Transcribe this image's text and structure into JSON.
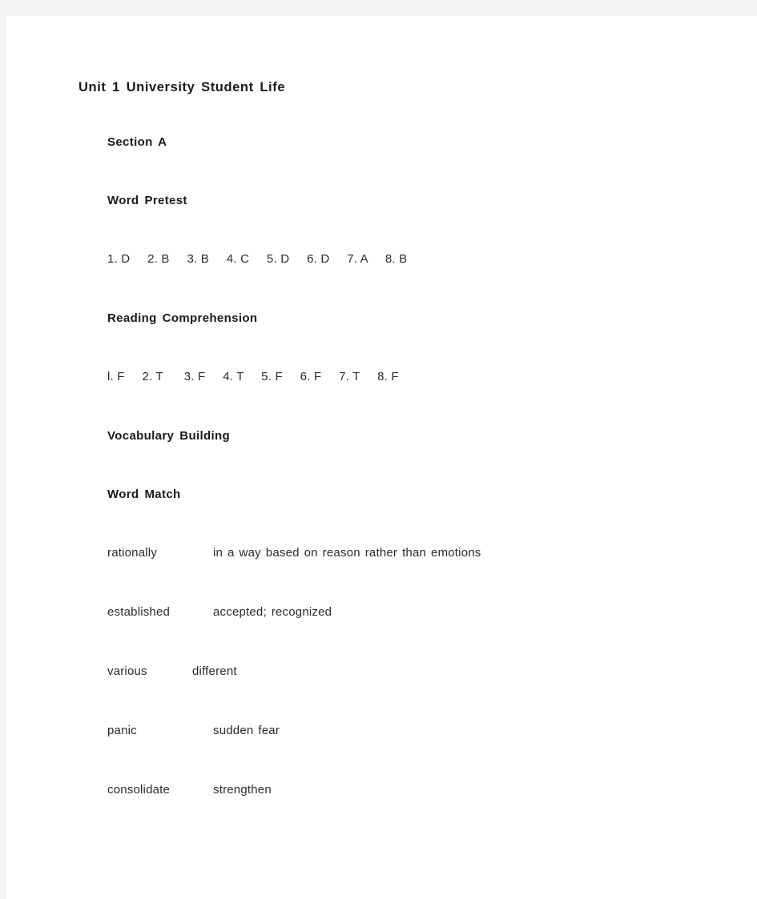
{
  "document": {
    "title": "Unit 1 University Student Life",
    "section_label": "Section A"
  },
  "word_pretest": {
    "heading": "Word Pretest",
    "answers_line": "1. D     2. B     3. B     4. C     5. D     6. D     7. A     8. B",
    "answers": [
      {
        "number": "1.",
        "value": "D"
      },
      {
        "number": "2.",
        "value": "B"
      },
      {
        "number": "3.",
        "value": "B"
      },
      {
        "number": "4.",
        "value": "C"
      },
      {
        "number": "5.",
        "value": "D"
      },
      {
        "number": "6.",
        "value": "D"
      },
      {
        "number": "7.",
        "value": "A"
      },
      {
        "number": "8.",
        "value": "B"
      }
    ]
  },
  "reading_comprehension": {
    "heading": "Reading Comprehension",
    "answers_line": "l. F     2. T      3. F     4. T     5. F     6. F     7. T     8. F",
    "answers": [
      {
        "number": "l.",
        "value": "F"
      },
      {
        "number": "2.",
        "value": "T"
      },
      {
        "number": "3.",
        "value": "F"
      },
      {
        "number": "4.",
        "value": "T"
      },
      {
        "number": "5.",
        "value": "F"
      },
      {
        "number": "6.",
        "value": "F"
      },
      {
        "number": "7.",
        "value": "T"
      },
      {
        "number": "8.",
        "value": "F"
      }
    ]
  },
  "vocabulary_building": {
    "heading": "Vocabulary Building",
    "word_match": {
      "heading": "Word Match",
      "pairs": [
        {
          "term": "rationally",
          "definition": "in a way based on reason rather than emotions",
          "term_width": 132
        },
        {
          "term": "established",
          "definition": "accepted; recognized",
          "term_width": 132
        },
        {
          "term": "various",
          "definition": "different",
          "term_width": 106
        },
        {
          "term": "panic",
          "definition": "sudden fear",
          "term_width": 132
        },
        {
          "term": "consolidate",
          "definition": "strengthen",
          "term_width": 132
        }
      ]
    }
  },
  "colors": {
    "page_background": "#ffffff",
    "canvas_background": "#f4f4f5",
    "heading_text": "#1a1a1a",
    "body_text": "#2b2b2b"
  }
}
